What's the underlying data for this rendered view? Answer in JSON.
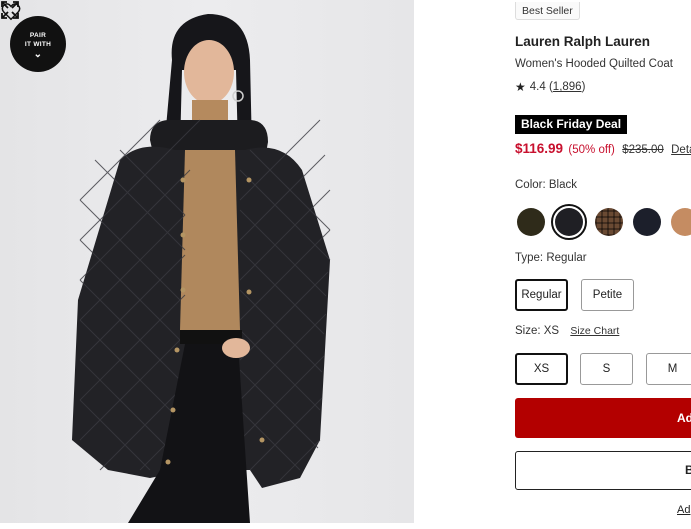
{
  "image": {
    "pair_label_line1": "PAIR",
    "pair_label_line2": "IT WITH"
  },
  "product": {
    "badge": "Best Seller",
    "brand": "Lauren Ralph Lauren",
    "name": "Women's Hooded Quilted Coat",
    "rating": "4.4",
    "review_count": "1,896",
    "deal_label": "Black Friday Deal",
    "price": "$116.99",
    "discount": "(50% off)",
    "original_price": "$235.00",
    "details_link": "Deta"
  },
  "color": {
    "label": "Color: Black",
    "swatches": [
      {
        "name": "olive",
        "color": "#2f2b1a"
      },
      {
        "name": "black",
        "color": "#1f1f24",
        "selected": true
      },
      {
        "name": "brown-plaid",
        "color": "#6a4a33"
      },
      {
        "name": "navy",
        "color": "#1c1f2b"
      },
      {
        "name": "camel",
        "color": "#c58c62"
      }
    ]
  },
  "type": {
    "label": "Type: Regular",
    "options": [
      "Regular",
      "Petite"
    ]
  },
  "size": {
    "label": "Size: XS",
    "chart_link": "Size Chart",
    "options": [
      "XS",
      "S",
      "M"
    ]
  },
  "actions": {
    "add_to_bag": "Ad",
    "secondary": "B",
    "bottom_link": "Ad"
  },
  "colors": {
    "accent_red": "#c8102e",
    "button_red": "#b30000"
  }
}
